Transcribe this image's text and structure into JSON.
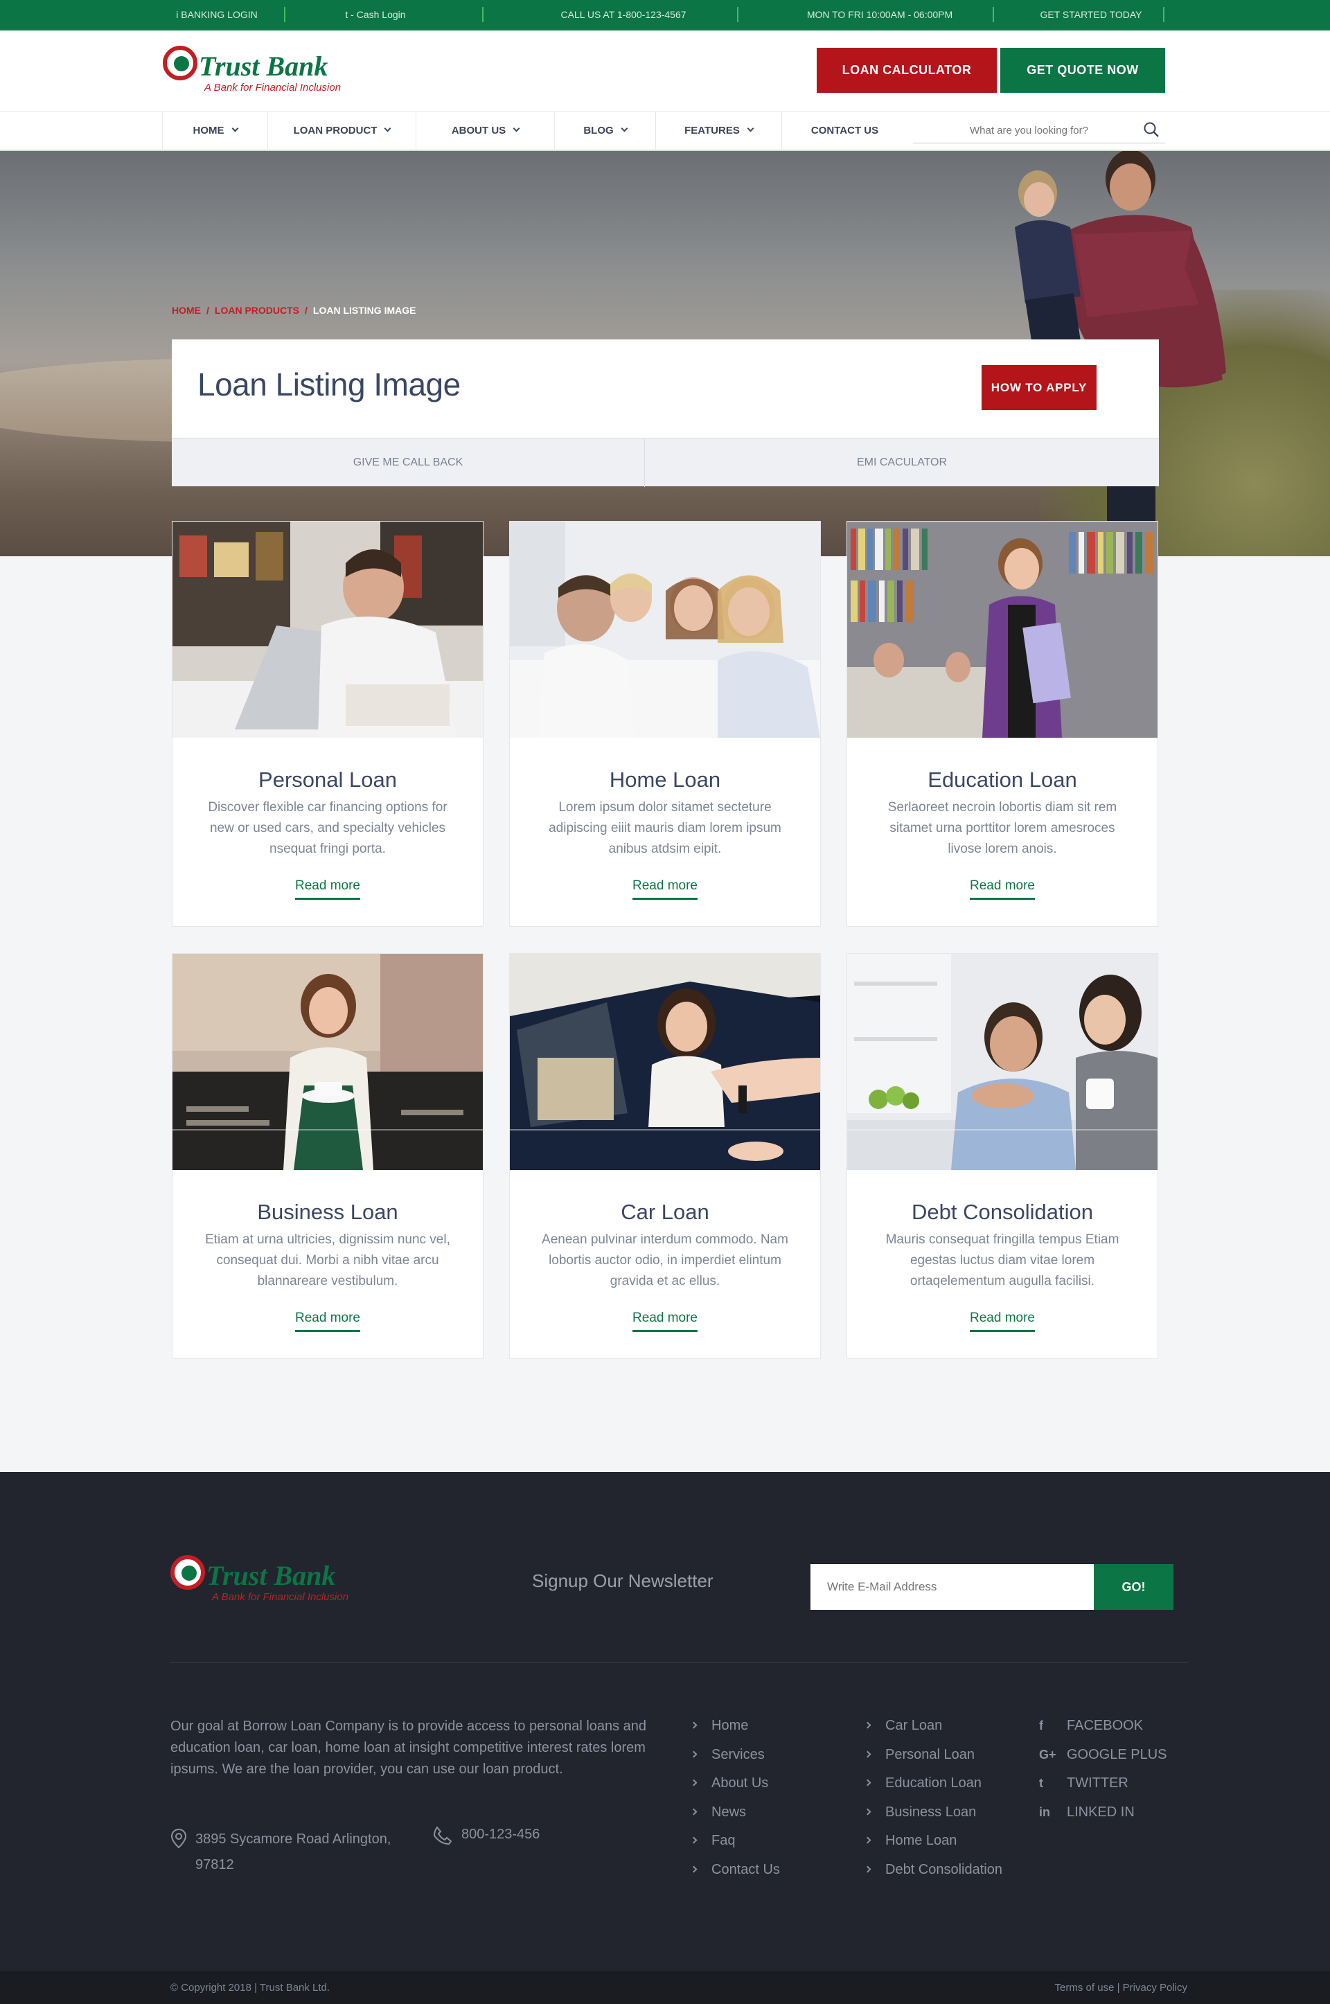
{
  "topbar": {
    "items": [
      "i BANKING LOGIN",
      "t - Cash Login",
      "CALL US AT 1-800-123-4567",
      "MON TO FRI 10:00AM - 06:00PM",
      "GET STARTED TODAY"
    ]
  },
  "brand": {
    "name": "Trust Bank",
    "tagline": "A Bank for Financial Inclusion",
    "colors": {
      "green": "#0c7545",
      "red": "#b3151b",
      "dark": "#22252d"
    }
  },
  "header": {
    "loan_calculator": "LOAN CALCULATOR",
    "get_quote": "GET QUOTE NOW"
  },
  "nav": {
    "items": [
      {
        "label": "HOME",
        "dropdown": true
      },
      {
        "label": "LOAN PRODUCT",
        "dropdown": true
      },
      {
        "label": "ABOUT US",
        "dropdown": true
      },
      {
        "label": "BLOG",
        "dropdown": true
      },
      {
        "label": "FEATURES",
        "dropdown": true
      },
      {
        "label": "CONTACT US",
        "dropdown": false
      }
    ],
    "search_placeholder": "What are you looking for?",
    "search_icon": "search-icon"
  },
  "breadcrumb": {
    "home": "HOME",
    "loan_products": "LOAN PRODUCTS",
    "current": "LOAN LISTING IMAGE"
  },
  "page": {
    "title": "Loan Listing Image",
    "how_to_apply": "HOW TO APPLY",
    "tabs": [
      "GIVE ME CALL BACK",
      "EMI CACULATOR"
    ]
  },
  "cards": [
    {
      "title": "Personal Loan",
      "desc": "Discover flexible car financing options for new or used cars, and specialty vehicles nsequat fringi porta.",
      "link": "Read more"
    },
    {
      "title": "Home Loan",
      "desc": "Lorem ipsum dolor sitamet secteture adipiscing eiiit mauris diam lorem ipsum anibus atdsim eipit.",
      "link": "Read more"
    },
    {
      "title": "Education Loan",
      "desc": "Serlaoreet necroin lobortis diam sit rem sitamet urna porttitor lorem amesroces livose lorem anois.",
      "link": "Read more"
    },
    {
      "title": "Business Loan",
      "desc": "Etiam at urna ultricies, dignissim nunc vel, consequat dui. Morbi a nibh vitae arcu blannareare vestibulum.",
      "link": "Read more"
    },
    {
      "title": "Car Loan",
      "desc": "Aenean pulvinar interdum commodo. Nam lobortis auctor odio, in imperdiet elintum gravida et ac ellus.",
      "link": "Read more"
    },
    {
      "title": "Debt Consolidation",
      "desc": "Mauris consequat fringilla tempus Etiam egestas luctus diam vitae lorem ortaqelementum augulla facilisi.",
      "link": "Read more"
    }
  ],
  "footer": {
    "newsletter_title": "Signup Our Newsletter",
    "email_placeholder": "Write E-Mail Address",
    "go": "GO!",
    "about": "Our goal at Borrow Loan Company is to provide access to personal loans and education loan, car loan, home loan at insight competitive interest rates lorem ipsums. We are the loan provider, you can use our loan product.",
    "address": "3895 Sycamore Road Arlington, 97812",
    "phone": "800-123-456",
    "links1": [
      "Home",
      "Services",
      "About Us",
      "News",
      "Faq",
      "Contact Us"
    ],
    "links2": [
      "Car Loan",
      "Personal Loan",
      "Education Loan",
      "Business Loan",
      "Home Loan",
      "Debt Consolidation"
    ],
    "social": [
      {
        "icon": "facebook-icon",
        "glyph": "f",
        "label": "FACEBOOK"
      },
      {
        "icon": "google-plus-icon",
        "glyph": "G+",
        "label": "GOOGLE PLUS"
      },
      {
        "icon": "twitter-icon",
        "glyph": "t",
        "label": "TWITTER"
      },
      {
        "icon": "linkedin-icon",
        "glyph": "in",
        "label": "LINKED IN"
      }
    ],
    "copyright": "© Copyright 2018 | Trust Bank Ltd.",
    "terms": "Terms of use | Privacy Policy"
  }
}
